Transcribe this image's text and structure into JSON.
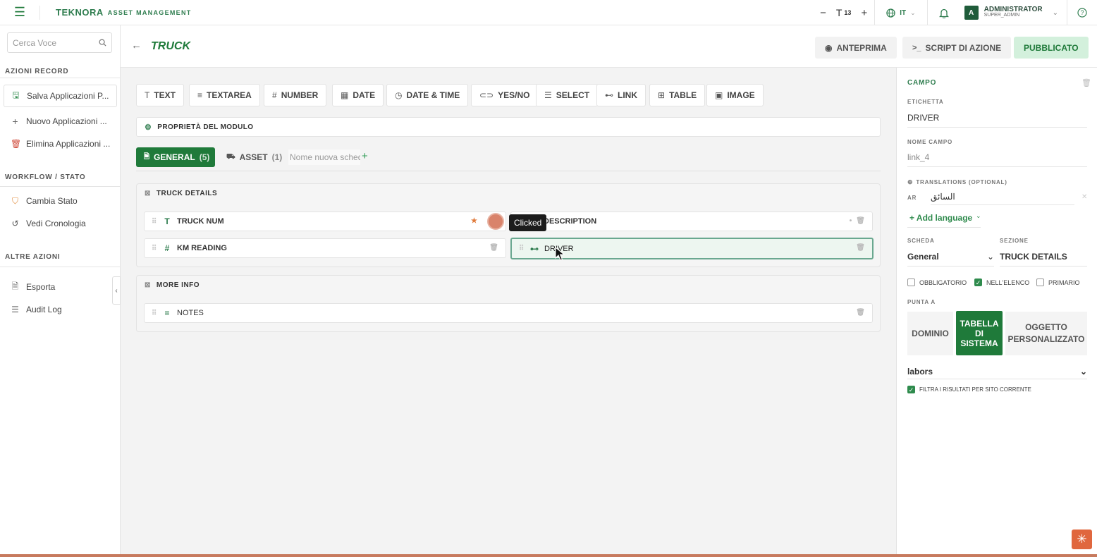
{
  "topbar": {
    "brand_name": "TEKNORA",
    "brand_sub": "ASSET MANAGEMENT",
    "font_minus": "−",
    "font_size": "13",
    "font_plus": "+",
    "lang": "IT",
    "user_initial": "A",
    "user_name": "ADMINISTRATOR",
    "user_role": "SUPER_ADMIN"
  },
  "sidebar": {
    "search_placeholder": "Cerca Voce",
    "section_record": "AZIONI RECORD",
    "item_save": "Salva Applicazioni P...",
    "item_new": "Nuovo Applicazioni ...",
    "item_delete": "Elimina Applicazioni ...",
    "section_workflow": "WORKFLOW / STATO",
    "item_change_state": "Cambia Stato",
    "item_history": "Vedi Cronologia",
    "section_other": "ALTRE AZIONI",
    "item_export": "Esporta",
    "item_audit": "Audit Log"
  },
  "header": {
    "title": "TRUCK",
    "preview": "ANTEPRIMA",
    "script": "SCRIPT DI AZIONE",
    "published": "PUBBLICATO"
  },
  "field_types": [
    "TEXT",
    "TEXTAREA",
    "NUMBER",
    "DATE",
    "DATE & TIME",
    "YES/NO",
    "SELECT",
    "LINK",
    "TABLE",
    "IMAGE"
  ],
  "module_props": "PROPRIETÀ DEL MODULO",
  "tabs": {
    "general_label": "GENERAL",
    "general_count": "(5)",
    "asset_label": "ASSET",
    "asset_count": "(1)",
    "new_tab_placeholder": "Nome nuova scheda"
  },
  "sections": {
    "truck_details": "TRUCK DETAILS",
    "more_info": "MORE INFO"
  },
  "fields": {
    "truck_num": "TRUCK NUM",
    "description": "DESCRIPTION",
    "km_reading": "KM READING",
    "driver": "DRIVER",
    "notes": "NOTES"
  },
  "overlay": {
    "tooltip": "Clicked"
  },
  "panel": {
    "title": "CAMPO",
    "label_label": "ETICHETTA",
    "label_value": "DRIVER",
    "fieldname_label": "NOME CAMPO",
    "fieldname_value": "link_4",
    "translations_label": "TRANSLATIONS (OPTIONAL)",
    "trans_lang": "AR",
    "trans_value": "السائق",
    "add_language": "+ Add language",
    "scheda_label": "SCHEDA",
    "scheda_value": "General",
    "sezione_label": "SEZIONE",
    "sezione_value": "TRUCK DETAILS",
    "chk_required": "OBBLIGATORIO",
    "chk_inlist": "NELL'ELENCO",
    "chk_primary": "PRIMARIO",
    "points_to_label": "PUNTA A",
    "seg_domain": "DOMINIO",
    "seg_system": "TABELLA DI SISTEMA",
    "seg_custom": "OGGETTO PERSONALIZZATO",
    "target_value": "labors",
    "filter_label": "FILTRA I RISULTATI PER SITO CORRENTE"
  },
  "colors": {
    "brand_green": "#1f7a3a",
    "published_bg": "#d3f0dc",
    "accent_orange": "#e0673e"
  }
}
